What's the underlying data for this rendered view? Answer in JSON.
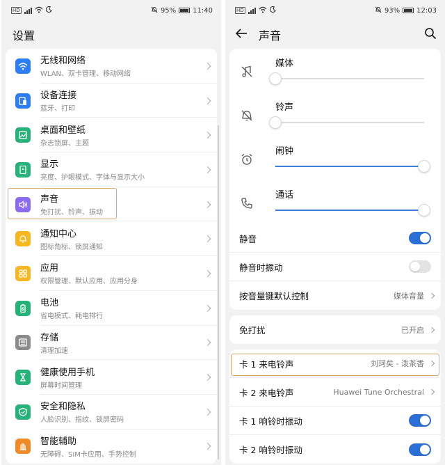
{
  "left": {
    "status": {
      "battery": "95%",
      "time": "11:40"
    },
    "title": "设置",
    "items": [
      {
        "label": "无线和网络",
        "sub": "WLAN、双卡管理、移动网络",
        "icon": "wifi-icon",
        "color": "#2d7df6"
      },
      {
        "label": "设备连接",
        "sub": "蓝牙、打印",
        "icon": "device-connection-icon",
        "color": "#2d7df6"
      },
      {
        "label": "桌面和壁纸",
        "sub": "杂志锁屏、主题",
        "icon": "wallpaper-icon",
        "color": "#27b27a"
      },
      {
        "label": "显示",
        "sub": "亮度、护眼模式、字体与显示大小",
        "icon": "display-icon",
        "color": "#27b27a"
      },
      {
        "label": "声音",
        "sub": "免打扰、铃声、振动",
        "icon": "sound-icon",
        "color": "#8a6cf0"
      },
      {
        "label": "通知中心",
        "sub": "图标角标、锁屏通知",
        "icon": "notification-icon",
        "color": "#f5b820"
      },
      {
        "label": "应用",
        "sub": "权限管理、默认应用、应用分身",
        "icon": "apps-icon",
        "color": "#f5b820"
      },
      {
        "label": "电池",
        "sub": "省电模式、耗电排行",
        "icon": "battery-icon",
        "color": "#27b27a"
      },
      {
        "label": "存储",
        "sub": "清理加速",
        "icon": "storage-icon",
        "color": "#8c8c8c"
      },
      {
        "label": "健康使用手机",
        "sub": "屏幕时间管理",
        "icon": "hourglass-icon",
        "color": "#27b27a"
      },
      {
        "label": "安全和隐私",
        "sub": "人脸识别、指纹、锁屏密码",
        "icon": "shield-icon",
        "color": "#27b27a"
      },
      {
        "label": "智能辅助",
        "sub": "无障碍、SIM卡应用、手势控制",
        "icon": "hand-icon",
        "color": "#f08a24"
      }
    ]
  },
  "right": {
    "status": {
      "battery": "93%",
      "time": "12:03"
    },
    "title": "声音",
    "volumes": [
      {
        "label": "媒体",
        "icon": "media-muted-icon",
        "level": 0.0
      },
      {
        "label": "铃声",
        "icon": "ring-muted-icon",
        "level": 0.0
      },
      {
        "label": "闹钟",
        "icon": "alarm-icon",
        "level": 1.0
      },
      {
        "label": "通话",
        "icon": "phone-icon",
        "level": 1.0
      }
    ],
    "rows1": [
      {
        "label": "静音",
        "type": "toggle",
        "on": true
      },
      {
        "label": "静音时振动",
        "type": "toggle",
        "on": false
      },
      {
        "label": "按音量键默认控制",
        "type": "link",
        "value": "媒体音量"
      }
    ],
    "rows2": [
      {
        "label": "免打扰",
        "type": "link",
        "value": "已开启"
      }
    ],
    "rows3": [
      {
        "label": "卡 1 来电铃声",
        "type": "link",
        "value": "刘珂矣 - 泼茶香"
      },
      {
        "label": "卡 2 来电铃声",
        "type": "link",
        "value": "Huawei Tune Orchestral"
      },
      {
        "label": "卡 1 响铃时振动",
        "type": "toggle",
        "on": true
      },
      {
        "label": "卡 2 响铃时振动",
        "type": "toggle",
        "on": true
      }
    ]
  },
  "colors": {
    "accent": "#2a6fd6",
    "highlight": "#d9a56b"
  }
}
